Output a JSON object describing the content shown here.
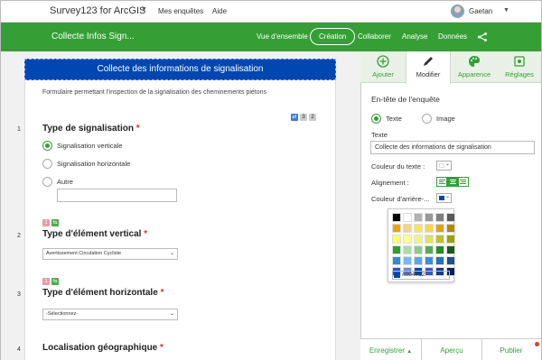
{
  "topnav": {
    "app_title": "Survey123 for ArcGIS",
    "links": [
      "Mes enquêtes",
      "Aide"
    ],
    "user_name": "Gaetan"
  },
  "greenbar": {
    "survey_title": "Collecte Infos Sign...",
    "tabs": [
      "Vue d'ensemble",
      "Création",
      "Collaborer",
      "Analyse",
      "Données"
    ],
    "active_tab": "Création"
  },
  "form": {
    "header_title": "Collecte des informations de signalisation",
    "description": "Formulaire permettant l'inspection de la signalisation des cheminements piétons",
    "q1": {
      "number": "1",
      "title": "Type de signalisation",
      "required_mark": "*",
      "badges": [
        "",
        "3",
        "2"
      ],
      "options": [
        "Signalisation verticale",
        "Signalisation horizontale",
        "Autre"
      ],
      "selected": "Signalisation verticale"
    },
    "q2": {
      "number": "2",
      "title": "Type d'élément vertical",
      "required_mark": "*",
      "badges": [
        "1",
        ""
      ],
      "value": "Avertissement Circulation Cycliste"
    },
    "q3": {
      "number": "3",
      "title": "Type d'élément horizontale",
      "required_mark": "*",
      "badges": [
        "1",
        ""
      ],
      "value": "-Sélectionnez-"
    },
    "q4": {
      "number": "4",
      "title": "Localisation géographique",
      "required_mark": "*"
    }
  },
  "rpanel": {
    "tabs": [
      "Ajouter",
      "Modifier",
      "Apparence",
      "Réglages"
    ],
    "active_tab": "Modifier",
    "section_title": "En-tête de l'enquête",
    "header_type": {
      "options": [
        "Texte",
        "Image"
      ],
      "selected": "Texte"
    },
    "text_label": "Texte",
    "text_value": "Collecte des informations de signalisation",
    "text_color_label": "Couleur du texte :",
    "text_color": "#ffffff",
    "alignment_label": "Alignement :",
    "alignment": "center",
    "bg_color_label": "Couleur d'arrière-...",
    "bg_color": "#0047b2",
    "palette": {
      "colors": [
        "#000000",
        "#ffffff",
        "#b3b3b3",
        "#999999",
        "#808080",
        "#595959",
        "#f2a000",
        "#f7d08a",
        "#ffe066",
        "#ffd24d",
        "#d9a520",
        "#b38600",
        "#ffff66",
        "#ffff99",
        "#f2f28a",
        "#e0e066",
        "#c0c030",
        "#a0a000",
        "#2ea02e",
        "#a8dca8",
        "#88cc88",
        "#55aa55",
        "#2a8a2a",
        "#1a5a1a",
        "#2e8bd6",
        "#77b8ee",
        "#5aa6e6",
        "#3f8fd6",
        "#2a6fb8",
        "#1a4f90",
        "#2255cc",
        "#6a88d8",
        "#0047b2",
        "#3a5ab8",
        "#1a3a90",
        "#0a2060"
      ],
      "hex_value": "#0047b2"
    },
    "footer": [
      "Enregistrer",
      "Aperçu",
      "Publier"
    ]
  }
}
